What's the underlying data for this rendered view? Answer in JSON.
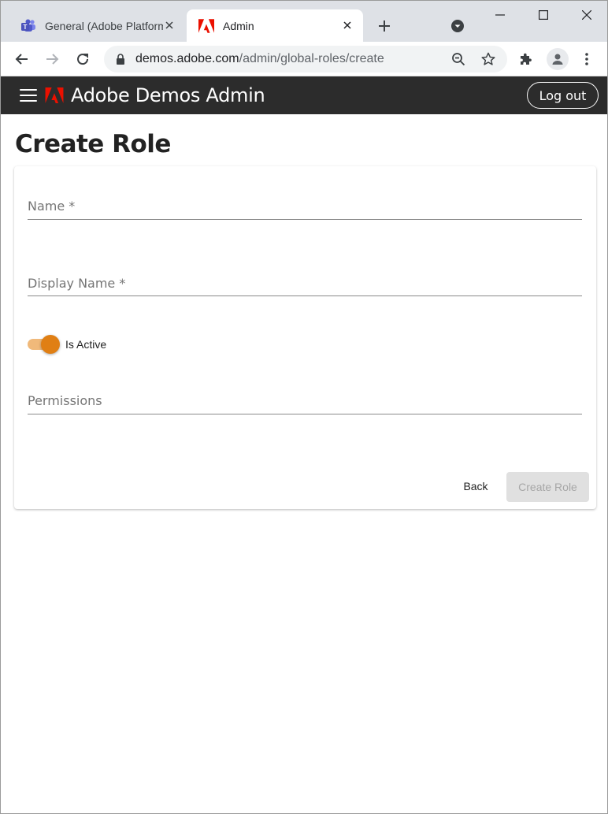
{
  "browser": {
    "tabs": [
      {
        "title": "General (Adobe Platform",
        "favicon": "teams-icon",
        "active": false
      },
      {
        "title": "Admin",
        "favicon": "adobe-icon",
        "active": true
      }
    ],
    "url": {
      "host": "demos.adobe.com",
      "path": "/admin/global-roles/create"
    }
  },
  "header": {
    "title": "Adobe Demos Admin",
    "logout_label": "Log out"
  },
  "page": {
    "title": "Create Role"
  },
  "form": {
    "name_label": "Name *",
    "display_name_label": "Display Name *",
    "is_active_label": "Is Active",
    "is_active": true,
    "permissions_label": "Permissions",
    "back_label": "Back",
    "create_label": "Create Role"
  },
  "colors": {
    "header_bg": "#2c2c2c",
    "toggle_accent": "#e07f14",
    "adobe_red": "#eb1000"
  }
}
